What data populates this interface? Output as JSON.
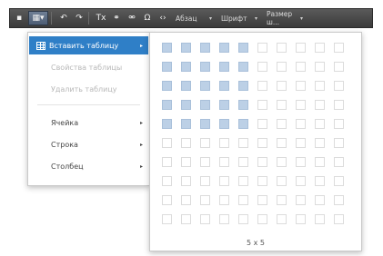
{
  "toolbar": {
    "buttons": [
      {
        "name": "save-icon",
        "glyph": "▪"
      },
      {
        "name": "table-icon",
        "glyph": "▦▾"
      },
      {
        "name": "undo-icon",
        "glyph": "↶"
      },
      {
        "name": "redo-icon",
        "glyph": "↷"
      },
      {
        "name": "clear-format-icon",
        "glyph": "Tx"
      },
      {
        "name": "link-icon",
        "glyph": "⚭"
      },
      {
        "name": "unlink-icon",
        "glyph": "⚮"
      },
      {
        "name": "special-char-icon",
        "glyph": "Ω"
      },
      {
        "name": "source-code-icon",
        "glyph": "‹›"
      }
    ],
    "selects": [
      {
        "name": "paragraph-select",
        "value": "Абзац"
      },
      {
        "name": "font-select",
        "value": "Шрифт"
      },
      {
        "name": "font-size-select",
        "value": "Размер ш..."
      }
    ]
  },
  "menu": {
    "items": [
      {
        "label": "Вставить таблицу",
        "state": "selected",
        "has_submenu": true
      },
      {
        "label": "Свойства таблицы",
        "state": "disabled",
        "has_submenu": false
      },
      {
        "label": "Удалить таблицу",
        "state": "disabled",
        "has_submenu": false
      },
      {
        "label": "Ячейка",
        "state": "normal",
        "has_submenu": true
      },
      {
        "label": "Строка",
        "state": "normal",
        "has_submenu": true
      },
      {
        "label": "Столбец",
        "state": "normal",
        "has_submenu": true
      }
    ]
  },
  "table_picker": {
    "rows": 10,
    "cols": 10,
    "selected_rows": 5,
    "selected_cols": 5,
    "size_label": "5 x 5",
    "highlight_color": "#bcd0e6"
  },
  "colors": {
    "toolbar_bg": "#474747",
    "selected_item": "#2f7fc7"
  }
}
